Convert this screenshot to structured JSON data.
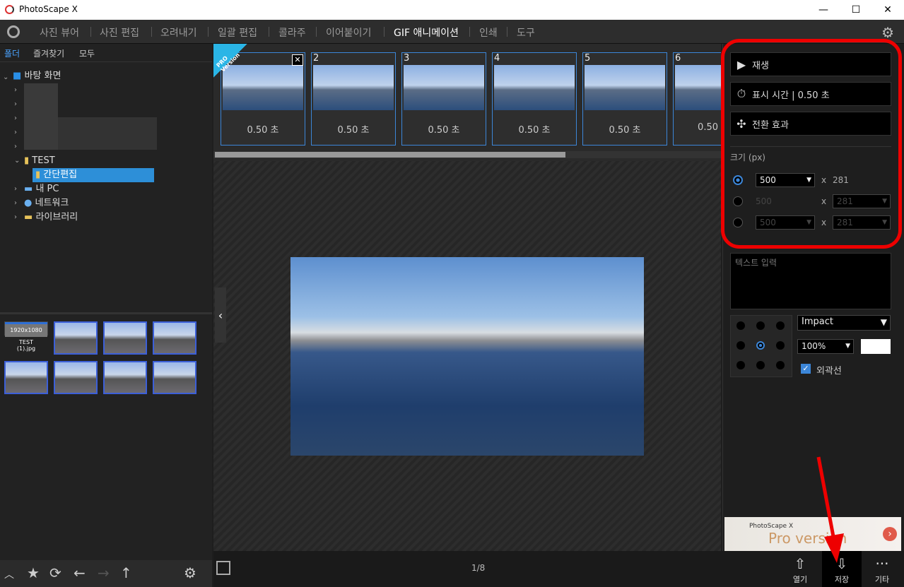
{
  "window": {
    "title": "PhotoScape X",
    "minimize": "—",
    "maximize": "☐",
    "close": "✕"
  },
  "menu": {
    "items": [
      "사진 뷰어",
      "사진 편집",
      "오려내기",
      "일괄 편집",
      "콜라주",
      "이어붙이기",
      "GIF 애니메이션",
      "인쇄",
      "도구"
    ],
    "active": "GIF 애니메이션"
  },
  "left": {
    "tabs": [
      "폴더",
      "즐겨찾기",
      "모두"
    ],
    "tree": {
      "desktop": "바탕 화면",
      "test": "TEST",
      "quick_edit": "간단편집",
      "my_pc": "내 PC",
      "network": "네트워크",
      "library": "라이브러리"
    },
    "first_thumb": {
      "size": "1920x1080",
      "name": "TEST",
      "file": "(1).jpg"
    }
  },
  "frames": [
    {
      "num": "",
      "duration": "0.50 초"
    },
    {
      "num": "2",
      "duration": "0.50 초"
    },
    {
      "num": "3",
      "duration": "0.50 초"
    },
    {
      "num": "4",
      "duration": "0.50 초"
    },
    {
      "num": "5",
      "duration": "0.50 초"
    },
    {
      "num": "6",
      "duration": "0.50"
    }
  ],
  "pro_badge": "PRO Version",
  "bottom": {
    "pager": "1/8",
    "open": "열기",
    "save": "저장",
    "more": "기타"
  },
  "right": {
    "play": "재생",
    "display_time": "표시 시간 | 0.50 초",
    "transition": "전환 효과",
    "size_label": "크기 (px)",
    "size_rows": [
      {
        "w": "500",
        "h": "281",
        "x": "x"
      },
      {
        "w": "500",
        "h": "281",
        "x": "x"
      },
      {
        "w": "500",
        "h": "281",
        "x": "x"
      }
    ],
    "text_placeholder": "텍스트 입력",
    "font": "Impact",
    "font_size": "100%",
    "outline_label": "외곽선",
    "ad_line1": "PhotoScape X",
    "ad_line2": "Pro version"
  },
  "colors": {
    "accent": "#3c86d8",
    "highlight": "#e00000"
  }
}
